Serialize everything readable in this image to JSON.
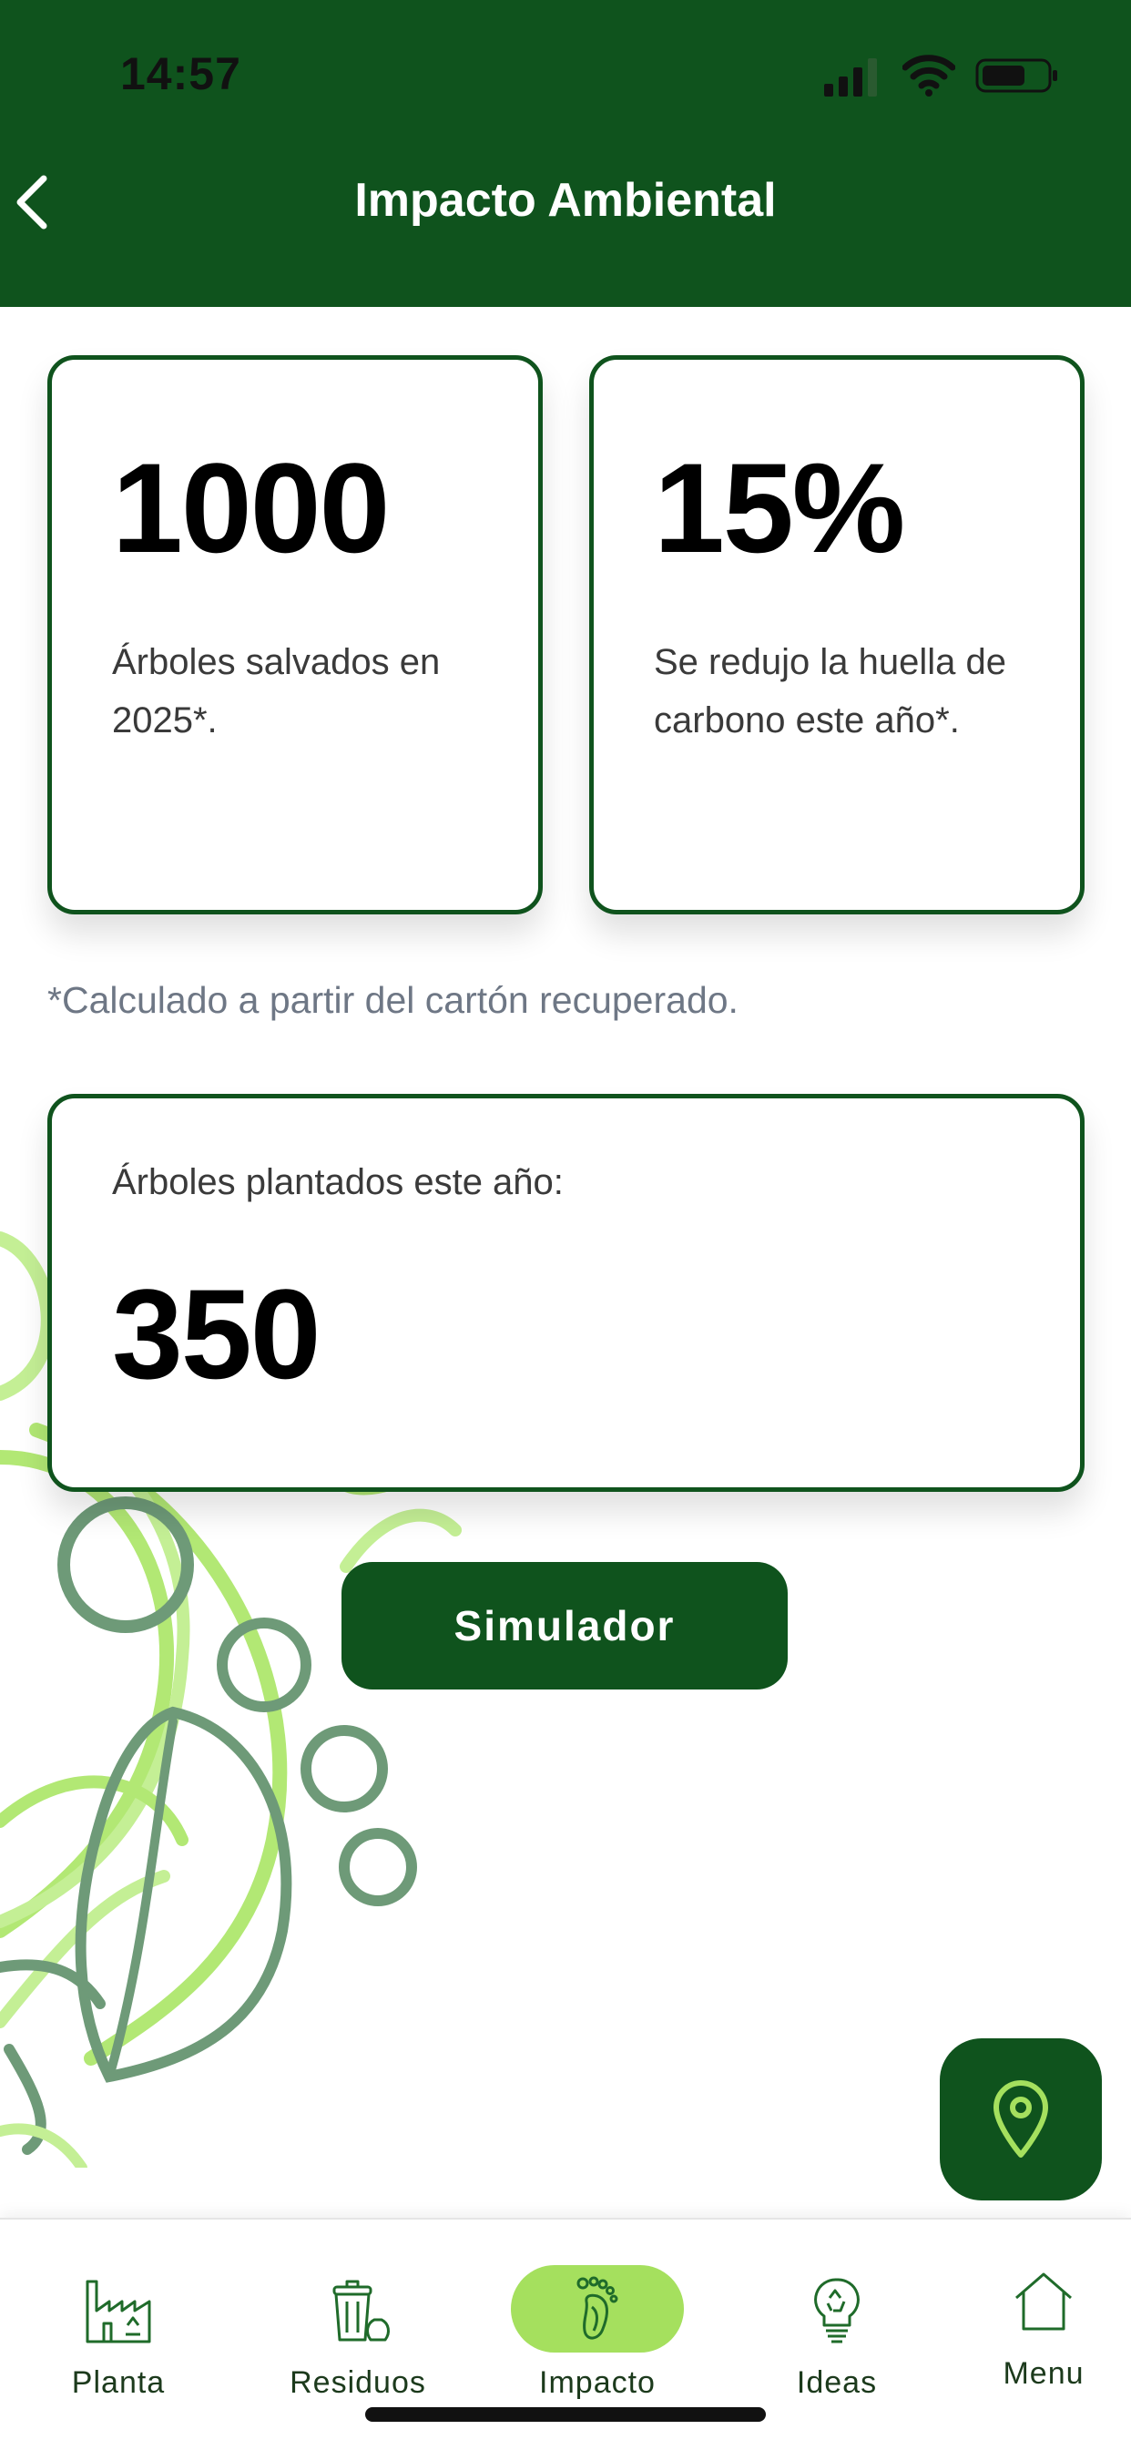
{
  "status_bar": {
    "time": "14:57"
  },
  "header": {
    "title": "Impacto Ambiental"
  },
  "cards": [
    {
      "value": "1000",
      "text": "Árboles salvados en 2025*."
    },
    {
      "value": "15%",
      "text": "Se redujo la huella de carbono este año*."
    }
  ],
  "footnote": "*Calculado a partir del cartón recuperado.",
  "planted": {
    "label": "Árboles plantados este año:",
    "value": "350"
  },
  "simulator_button": "Simulador",
  "nav": [
    {
      "label": "Planta",
      "icon": "factory-icon"
    },
    {
      "label": "Residuos",
      "icon": "trash-bin-icon"
    },
    {
      "label": "Impacto",
      "icon": "footprint-icon",
      "active": true
    },
    {
      "label": "Ideas",
      "icon": "lightbulb-recycle-icon"
    },
    {
      "label": "Menu",
      "icon": "home-icon"
    }
  ],
  "colors": {
    "primary": "#0f531d",
    "accent": "#a5e05e",
    "text_muted": "#6e7785"
  }
}
